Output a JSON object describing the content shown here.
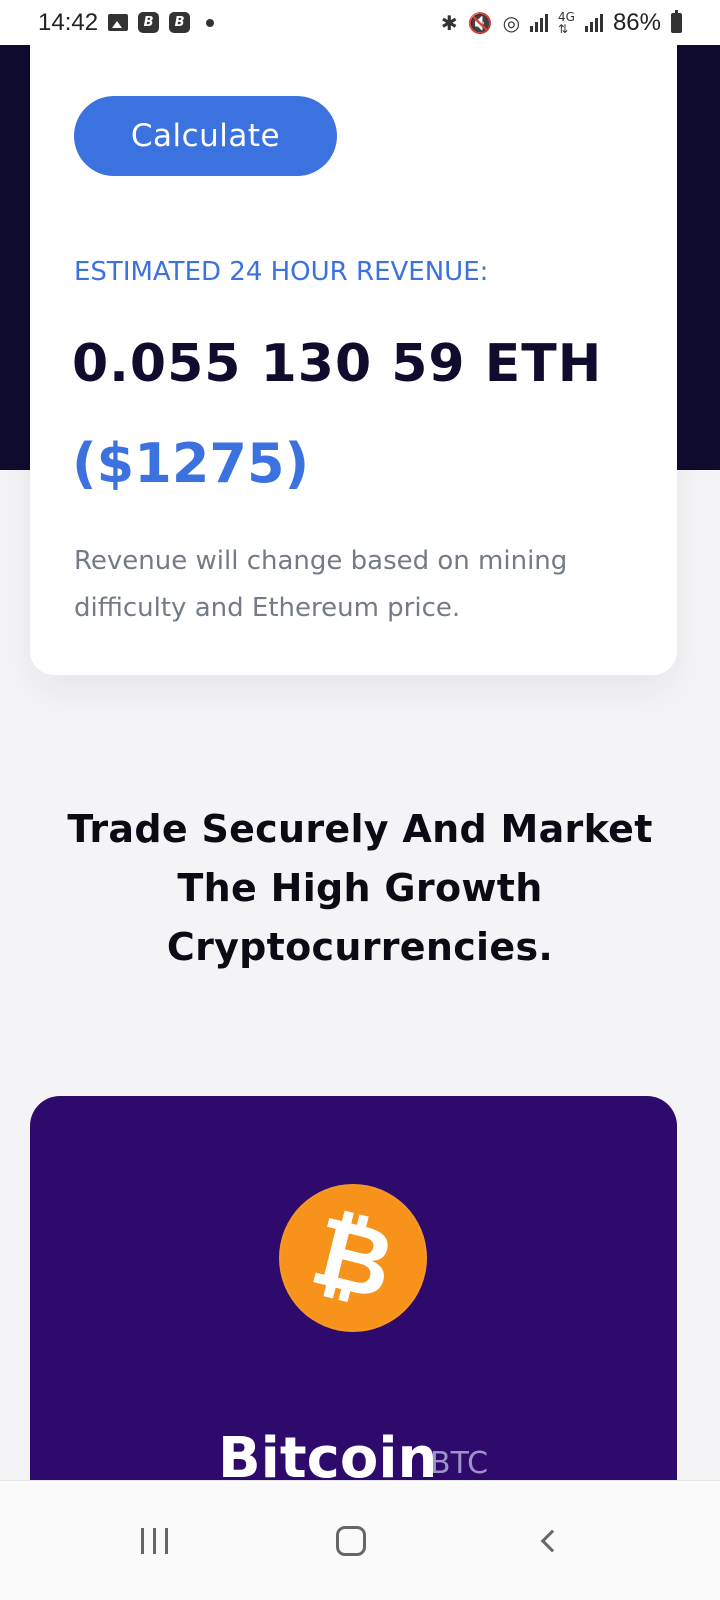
{
  "status_bar": {
    "time": "14:42",
    "notification_icons": [
      "gallery-icon",
      "b-app-icon",
      "b-app-icon",
      "dot-icon"
    ],
    "battery_percent": "86%",
    "right_icons": [
      "bluetooth-icon",
      "mute-icon",
      "hotspot-icon",
      "signal-icon",
      "4g-icon",
      "signal-icon",
      "battery-icon"
    ]
  },
  "calculator_card": {
    "calculate_label": "Calculate",
    "estimate_label": "ESTIMATED 24 HOUR REVENUE:",
    "eth_amount": "0.055 130 59 ETH",
    "usd_amount": "($1275)",
    "note": "Revenue will change based on mining difficulty and Ethereum price."
  },
  "headline": {
    "text": "Trade Securely And Market The High Growth Cryptocurrencies."
  },
  "coin_card": {
    "logo_glyph": "₿",
    "name": "Bitcoin",
    "symbol": "BTC",
    "background_color": "#2d0a6c",
    "logo_color": "#f7931a"
  },
  "nav_bar": {
    "icons": [
      "recents-icon",
      "home-icon",
      "back-icon"
    ]
  },
  "colors": {
    "accent": "#3b72e0",
    "hero_dark": "#0f0c2e",
    "muted_text": "#747b87"
  }
}
